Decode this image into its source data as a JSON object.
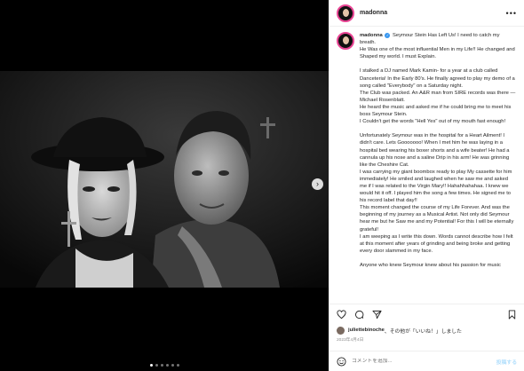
{
  "post": {
    "username": "madonna",
    "more_icon": "more-horizontal-icon",
    "carousel": {
      "total_slides": 6,
      "active_slide": 1,
      "next_icon": "chevron-right-icon"
    },
    "caption": {
      "username": "madonna",
      "first_line": "Seymour Stein Has Left Us! I need to catch my breath.",
      "paragraphs": [
        "He Was one of the most influential Men in my Life!! He changed and Shaped my world. I must Explain.",
        "",
        "I stalked a DJ named Mark Kamin- for a year at a club called Danceteria! In the Early 80's. He finally agreed to play my demo of a song called \"Everybody\" on a Saturday night.",
        "The Club was packed. An A&R man from SIRE records was there —Michael Rosenblatt.",
        "He heard the music and asked me if he could bring me to meet his boss Seymour Stein.",
        "I Couldn't get the words \"Hell Yes\" out of my mouth fast enough!",
        "",
        "Unfortunately Seymour was in the hospital for a Heart Ailment! I didn't care. Lets Gooooooo! When I met him he was laying in a hospital bed wearing his boxer shorts and a wife beater! He had a cannula up his nose and a saline Drip in his arm! He was grinning like the Cheshire Cat.",
        "I was carrying my giant boombox ready to play My cassette for him immediately! He smiled and laughed when he saw me and asked me if I was related to the Virgin Mary!! Hahahhahahaa. I knew we would hit it off. I played him the song a few times. He signed me to his record label that day!!",
        "This moment changed the course of my Life Forever. And was the beginning of my journey as a Musical Artist. Not only did Seymour hear me but he Saw me and my Potential! For this I will be eternally grateful!",
        "I am weeping as I write this down. Words cannot describe how I felt at this moment after years of grinding and being broke and getting every door slammed in my face.",
        "",
        "Anyone who knew Seymour knew about his passion for music"
      ]
    },
    "actions": {
      "like_icon": "heart-icon",
      "comment_icon": "comment-icon",
      "share_icon": "share-icon",
      "save_icon": "bookmark-icon"
    },
    "likes": {
      "liker": "juliettebinoche",
      "suffix": "、その他が「いいね！」しました"
    },
    "date": "2023年4月4日",
    "comment_box": {
      "emoji_icon": "emoji-icon",
      "placeholder": "コメントを追加...",
      "post_label": "投稿する"
    }
  }
}
